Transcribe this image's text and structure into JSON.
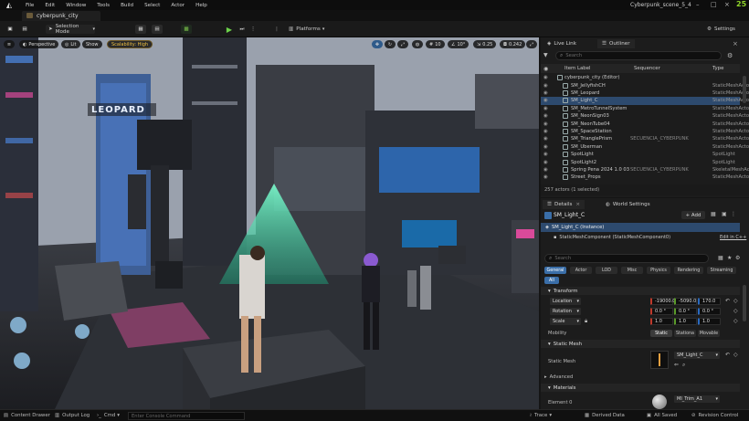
{
  "menubar": {
    "items": [
      "File",
      "Edit",
      "Window",
      "Tools",
      "Build",
      "Select",
      "Actor",
      "Help"
    ],
    "project_title": "Cyberpunk_scene_5_4",
    "version_badge": "25"
  },
  "tabbar": {
    "level_tab": "cyberpunk_city"
  },
  "toolbar": {
    "selection_mode": "Selection Mode",
    "platforms": "Platforms",
    "settings": "Settings"
  },
  "viewport": {
    "perspective": "Perspective",
    "lit": "Lit",
    "show": "Show",
    "scalability": "Scalability: High",
    "grid_snap": "10",
    "rot_snap": "10°",
    "scale_snap": "0.25",
    "cam_speed": "0.242",
    "sign_text": "LEOPARD"
  },
  "outliner": {
    "tab_live_link": "Live Link",
    "tab_outliner": "Outliner",
    "search_placeholder": "Search",
    "col_item_label": "Item Label",
    "col_sequencer": "Sequencer",
    "col_type": "Type",
    "rows": [
      {
        "label": "cyberpunk_city (Editor)",
        "type": "",
        "seq": ""
      },
      {
        "label": "SM_JellyfishCH",
        "type": "StaticMeshActor",
        "seq": ""
      },
      {
        "label": "SM_Leopard",
        "type": "StaticMeshActor",
        "seq": ""
      },
      {
        "label": "SM_Light_C",
        "type": "StaticMeshActor",
        "seq": ""
      },
      {
        "label": "SM_MetroTunnelSystem",
        "type": "StaticMeshActor",
        "seq": ""
      },
      {
        "label": "SM_NeonSign03",
        "type": "StaticMeshActor",
        "seq": ""
      },
      {
        "label": "SM_NeonTube04",
        "type": "StaticMeshActor",
        "seq": ""
      },
      {
        "label": "SM_SpaceStation",
        "type": "StaticMeshActor",
        "seq": ""
      },
      {
        "label": "SM_TrianglePrism",
        "type": "StaticMeshActor",
        "seq": "SECUENCIA_CYBERPUNK"
      },
      {
        "label": "SM_Uberman",
        "type": "StaticMeshActor",
        "seq": ""
      },
      {
        "label": "SpotLight",
        "type": "SpotLight",
        "seq": ""
      },
      {
        "label": "SpotLight2",
        "type": "SpotLight",
        "seq": ""
      },
      {
        "label": "Spring Pena 2024 1.0 03",
        "type": "SkeletalMeshActor",
        "seq": "SECUENCIA_CYBERPUNK"
      },
      {
        "label": "Street_Props",
        "type": "StaticMeshActor",
        "seq": ""
      }
    ],
    "actor_count": "257 actors (1 selected)"
  },
  "details": {
    "tab_details": "Details",
    "tab_world": "World Settings",
    "actor_name": "SM_Light_C",
    "add_button": "+ Add",
    "instance": "SM_Light_C (Instance)",
    "component": "StaticMeshComponent (StaticMeshComponent0)",
    "edit_cpp": "Edit in C++",
    "search_placeholder": "Search",
    "categories": [
      "General",
      "Actor",
      "LOD",
      "Misc",
      "Physics",
      "Rendering",
      "Streaming"
    ],
    "all_label": "All",
    "transform_header": "Transform",
    "location_label": "Location",
    "rotation_label": "Rotation",
    "scale_label": "Scale",
    "location": [
      "-19000.0",
      "-5090.0",
      "170.0"
    ],
    "rotation": [
      "0.0 °",
      "0.0 °",
      "0.0 °"
    ],
    "scale": [
      "1.0",
      "1.0",
      "1.0"
    ],
    "mobility_label": "Mobility",
    "mobility_options": [
      "Static",
      "Stationa",
      "Movable"
    ],
    "static_mesh_header": "Static Mesh",
    "static_mesh_label": "Static Mesh",
    "static_mesh_value": "SM_Light_C",
    "advanced": "Advanced",
    "materials_header": "Materials",
    "element0_label": "Element 0",
    "element0_value": "MI_Trim_A1"
  },
  "statusbar": {
    "content_drawer": "Content Drawer",
    "output_log": "Output Log",
    "cmd": "Cmd",
    "console_placeholder": "Enter Console Command",
    "trace": "Trace",
    "derived_data": "Derived Data",
    "all_saved": "All Saved",
    "revision_control": "Revision Control"
  },
  "colors": {
    "accent": "#3a6ea8",
    "selected_row": "#2d4a6e",
    "ok_green": "#8fd42a"
  }
}
